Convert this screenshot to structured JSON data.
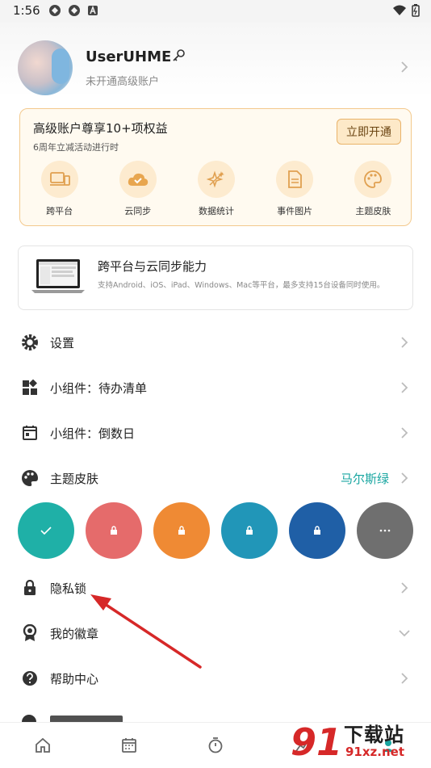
{
  "status_bar": {
    "time": "1:56"
  },
  "profile": {
    "username": "UserUHME",
    "subtitle": "未开通高级账户"
  },
  "premium": {
    "title": "高级账户尊享10+项权益",
    "subtitle": "6周年立减活动进行时",
    "button_label": "立即开通",
    "benefits": [
      {
        "label": "跨平台",
        "icon": "devices-icon"
      },
      {
        "label": "云同步",
        "icon": "cloud-sync-icon"
      },
      {
        "label": "数据统计",
        "icon": "sparkle-icon"
      },
      {
        "label": "事件图片",
        "icon": "document-icon"
      },
      {
        "label": "主题皮肤",
        "icon": "palette-icon"
      }
    ]
  },
  "sync_card": {
    "title": "跨平台与云同步能力",
    "description": "支持Android、iOS、iPad、Windows、Mac等平台，最多支持15台设备同时使用。"
  },
  "menu": {
    "settings": "设置",
    "widget_todo": "小组件：待办清单",
    "widget_countdown": "小组件：倒数日",
    "theme": "主题皮肤",
    "theme_value": "马尔斯绿",
    "privacy_lock": "隐私锁",
    "badges": "我的徽章",
    "help": "帮助中心"
  },
  "theme_swatches": [
    {
      "color": "#1fb0a7",
      "state": "selected"
    },
    {
      "color": "#e56b6b",
      "state": "locked"
    },
    {
      "color": "#ef8a34",
      "state": "locked"
    },
    {
      "color": "#2196b8",
      "state": "locked"
    },
    {
      "color": "#1f5fa6",
      "state": "locked"
    },
    {
      "color": "#6f6f6f",
      "state": "more"
    }
  ],
  "colors": {
    "accent": "#19a6a1",
    "premium_border": "#f3c98d",
    "arrow": "#d62828"
  },
  "watermark": {
    "brand": "下载站",
    "domain": "91xz.net"
  }
}
